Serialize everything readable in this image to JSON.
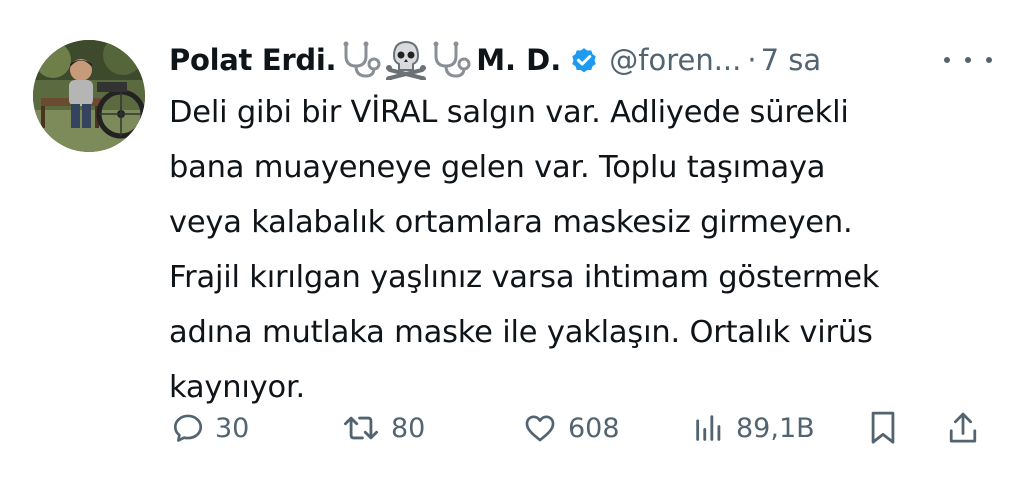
{
  "tweet": {
    "author": {
      "display_name": "Polat Erdi.",
      "name_suffix": "M. D.",
      "handle": "@foren...",
      "emoji_icons": [
        "stethoscope-icon",
        "skull-crossbones-icon",
        "stethoscope-icon"
      ],
      "verified_color": "#1d9bf0"
    },
    "separator": "·",
    "time": "7 sa",
    "body_lines": [
      "Deli gibi bir VİRAL salgın var. Adliyede sürekli",
      "bana muayeneye gelen var. Toplu taşımaya",
      "veya kalabalık ortamlara maskesiz girmeyen.",
      "Frajil kırılgan yaşlınız varsa ihtimam göstermek",
      "adına mutlaka maske ile yaklaşın. Ortalık virüs",
      "kaynıyor."
    ],
    "actions": {
      "replies": "30",
      "reposts": "80",
      "likes": "608",
      "views": "89,1B"
    }
  },
  "colors": {
    "text": "#0f1419",
    "muted": "#536471",
    "accent": "#1d9bf0"
  }
}
